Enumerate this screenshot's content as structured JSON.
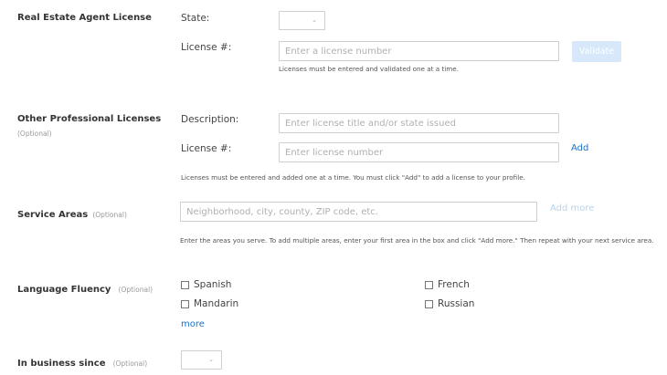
{
  "real_estate_license": {
    "section_label": "Real Estate Agent License",
    "state_label": "State:",
    "state_value": "",
    "license_label": "License #:",
    "license_placeholder": "Enter a license number",
    "validate_label": "Validate",
    "help_text": "Licenses must be entered and validated one at a time."
  },
  "other_licenses": {
    "section_label": "Other Professional Licenses",
    "optional_label": "(Optional)",
    "description_label": "Description:",
    "description_placeholder": "Enter license title and/or state issued",
    "license_label": "License #:",
    "license_placeholder": "Enter license number",
    "add_label": "Add",
    "help_text": "Licenses must be entered and added one at a time. You must click \"Add\" to add a license to your profile."
  },
  "service_areas": {
    "section_label": "Service Areas",
    "optional_label": "(Optional)",
    "placeholder": "Neighborhood, city, county, ZIP code, etc.",
    "add_more_label": "Add more",
    "help_text": "Enter the areas you serve. To add multiple areas, enter your first area in the box and click \"Add more.\" Then repeat with your next service area."
  },
  "language_fluency": {
    "section_label": "Language Fluency",
    "optional_label": "(Optional)",
    "languages": [
      {
        "label": "Spanish",
        "checked": false
      },
      {
        "label": "French",
        "checked": false
      },
      {
        "label": "Mandarin",
        "checked": false
      },
      {
        "label": "Russian",
        "checked": false
      }
    ],
    "more_label": "more"
  },
  "in_business_since": {
    "section_label": "In business since",
    "optional_label": "(Optional)",
    "year_value": ""
  },
  "icons": {
    "dropdown": "chevron-down-icon",
    "checkbox": "checkbox-icon"
  },
  "colors": {
    "link": "#1a73c8",
    "link_disabled": "#b8d3ee",
    "button_disabled": "#d6e8fa",
    "input_border": "#cfcfcf",
    "placeholder": "#b0b0b0"
  }
}
